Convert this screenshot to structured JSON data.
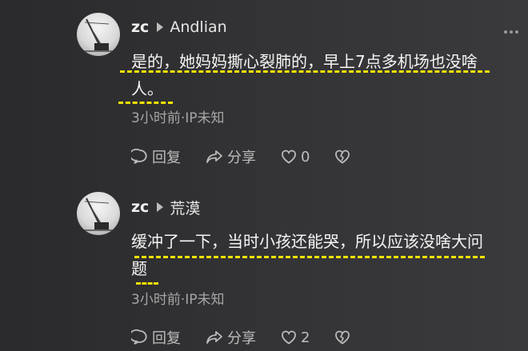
{
  "comments": [
    {
      "user": "zc",
      "reply_to": "Andlian",
      "text_line1": "是的，她妈妈撕心裂肺的，早上7点多机场也没啥",
      "text_line2": "人。",
      "meta": "3小时前·IP未知",
      "reply_label": "回复",
      "share_label": "分享",
      "like_count": "0"
    },
    {
      "user": "zc",
      "reply_to": "荒漠",
      "text_line1": "缓冲了一下，当时小孩还能哭，所以应该没啥大问",
      "text_line2": "题",
      "meta": "3小时前·IP未知",
      "reply_label": "回复",
      "share_label": "分享",
      "like_count": "2"
    }
  ],
  "icons": [
    "comment-bubble-icon",
    "share-icon",
    "heart-icon",
    "broken-heart-icon",
    "more-icon"
  ],
  "colors": {
    "highlight": "#f2e200",
    "background": "#2f2f31",
    "text": "#f5f5f5",
    "muted": "#a6a6a6"
  }
}
